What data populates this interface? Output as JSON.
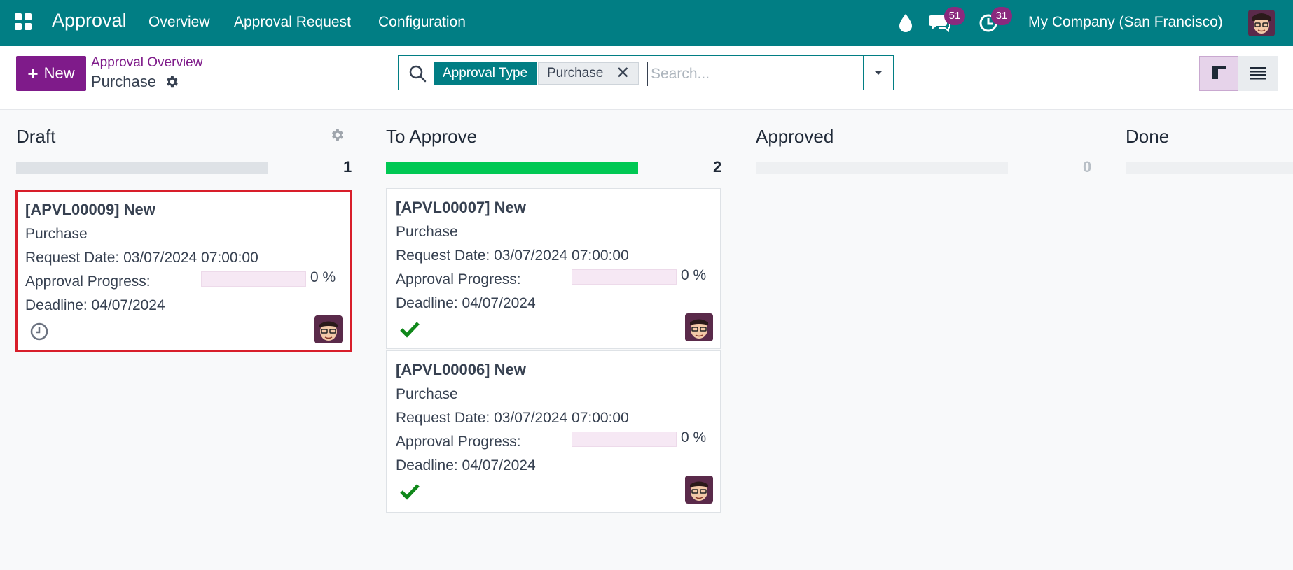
{
  "navbar": {
    "app_title": "Approval",
    "menu": [
      "Overview",
      "Approval Request",
      "Configuration"
    ],
    "messages_count": "51",
    "activities_count": "31",
    "company": "My Company (San Francisco)"
  },
  "control": {
    "new_label": "New",
    "breadcrumb_parent": "Approval Overview",
    "breadcrumb_current": "Purchase",
    "search": {
      "facet_label": "Approval Type",
      "facet_value": "Purchase",
      "placeholder": "Search..."
    }
  },
  "kanban": {
    "columns": [
      {
        "title": "Draft",
        "count": "1",
        "progress": 0,
        "has_settings": true
      },
      {
        "title": "To Approve",
        "count": "2",
        "progress": 1.0
      },
      {
        "title": "Approved",
        "count": "0",
        "progress": 0
      },
      {
        "title": "Done",
        "count": "",
        "progress": 0
      }
    ],
    "cards": [
      {
        "title": "[APVL00009] New",
        "type": "Purchase",
        "request_date": "Request Date: 03/07/2024 07:00:00",
        "progress_label": "Approval Progress:",
        "progress_pct": "0 %",
        "deadline": "Deadline: 04/07/2024",
        "status_icon": "clock-icon",
        "selected": true
      },
      {
        "title": "[APVL00007] New",
        "type": "Purchase",
        "request_date": "Request Date: 03/07/2024 07:00:00",
        "progress_label": "Approval Progress:",
        "progress_pct": "0 %",
        "deadline": "Deadline: 04/07/2024",
        "status_icon": "check-icon"
      },
      {
        "title": "[APVL00006] New",
        "type": "Purchase",
        "request_date": "Request Date: 03/07/2024 07:00:00",
        "progress_label": "Approval Progress:",
        "progress_pct": "0 %",
        "deadline": "Deadline: 04/07/2024",
        "status_icon": "check-icon"
      }
    ]
  },
  "colors": {
    "brand": "#017e84",
    "primary_button": "#7f1b8a",
    "badge": "#8b2a7e",
    "progress_green": "#00c853",
    "selected_border": "#d81e2a",
    "check_green": "#10881a"
  }
}
